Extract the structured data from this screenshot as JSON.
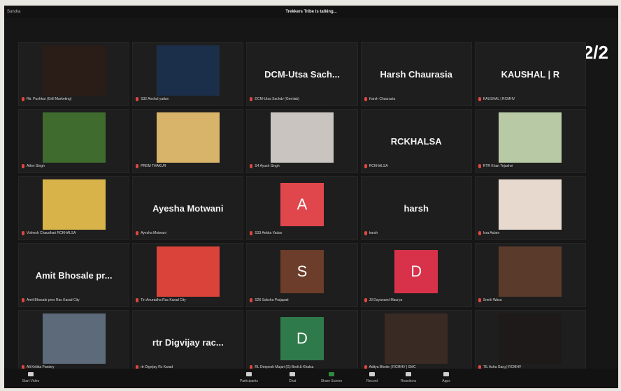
{
  "topbar": {
    "left_text": "Sundra",
    "center_text": "Trekkers Tribe is talking..."
  },
  "page_indicator": "2/2",
  "tiles": [
    {
      "caption": "Rtr. Pushkar (Grill Marketing)",
      "type": "video",
      "video_color": "#2a1d18"
    },
    {
      "caption": "S32 Anshul yadav",
      "type": "video",
      "video_color": "#1c2f4a"
    },
    {
      "caption": "DCM-Utsa Sachdv (Gemlab)",
      "type": "name",
      "big_name": "DCM-Utsa Sach..."
    },
    {
      "caption": "Harsh Chaurasia",
      "type": "name",
      "big_name": "Harsh Chaurasia"
    },
    {
      "caption": "KAUSHAL | RCMHV",
      "type": "name",
      "big_name": "KAUSHAL | R"
    },
    {
      "caption": "Athrv Singh",
      "type": "video",
      "video_color": "#3f6b2e"
    },
    {
      "caption": "PREM THAKUR",
      "type": "video",
      "video_color": "#d8b46a"
    },
    {
      "caption": "S4 Ayush Singh",
      "type": "video",
      "video_color": "#c9c4c0"
    },
    {
      "caption": "RCKHALSA",
      "type": "name",
      "big_name": "RCKHALSA"
    },
    {
      "caption": "RTR Khan Tejashvi",
      "type": "video",
      "video_color": "#b8c9a6"
    },
    {
      "caption": "Vishesh Chaudhari RCKHALSA",
      "type": "video",
      "video_color": "#d8b34a"
    },
    {
      "caption": "Ayesha Motwani",
      "type": "name",
      "big_name": "Ayesha Motwani"
    },
    {
      "caption": "S33 Ankita Yadav",
      "type": "letter",
      "letter": "A",
      "letter_bg": "#e0474c"
    },
    {
      "caption": "harsh",
      "type": "name",
      "big_name": "harsh"
    },
    {
      "caption": "Isra Aslam",
      "type": "video",
      "video_color": "#e8d9cf"
    },
    {
      "caption": "Amit Bhosale pres Rac Karad City",
      "type": "name",
      "big_name": "Amit Bhosale pr..."
    },
    {
      "caption": "Tin Anuradha Rac Karad City",
      "type": "video",
      "video_color": "#d9433a"
    },
    {
      "caption": "S26 Saksha Prajapati",
      "type": "letter",
      "letter": "S",
      "letter_bg": "#6b3d2a"
    },
    {
      "caption": "J3 Dayanand Maurya",
      "type": "letter",
      "letter": "D",
      "letter_bg": "#d8324a"
    },
    {
      "caption": "Smriti Wasu",
      "type": "video",
      "video_color": "#5a3a2a"
    },
    {
      "caption": "Alt Kritika Pandey",
      "type": "video",
      "video_color": "#5c6a7a"
    },
    {
      "caption": "rtr Digvijay Rc Karad",
      "type": "name",
      "big_name": "rtr Digvijay rac..."
    },
    {
      "caption": "RL Deepesh Mujari (G) Bedi & Khalsa",
      "type": "letter",
      "letter": "D",
      "letter_bg": "#2f7a4a"
    },
    {
      "caption": "Aditya Bhoite | RCMHV | SMC",
      "type": "video",
      "video_color": "#3a2a24"
    },
    {
      "caption": "TIL Asha Garg | RCMHV",
      "type": "video",
      "video_color": "#1d1a19"
    }
  ],
  "toolbar": [
    {
      "label": "Start Video",
      "icon": "video-off-icon"
    },
    {
      "label": "Participants",
      "icon": "participants-icon"
    },
    {
      "label": "Chat",
      "icon": "chat-icon"
    },
    {
      "label": "Share Screen",
      "icon": "share-screen-icon"
    },
    {
      "label": "Record",
      "icon": "record-icon"
    },
    {
      "label": "Reactions",
      "icon": "reactions-icon"
    },
    {
      "label": "Apps",
      "icon": "apps-icon"
    }
  ],
  "colors": {
    "share_green": "#2d8c3c",
    "muted_red": "#e0473f"
  }
}
